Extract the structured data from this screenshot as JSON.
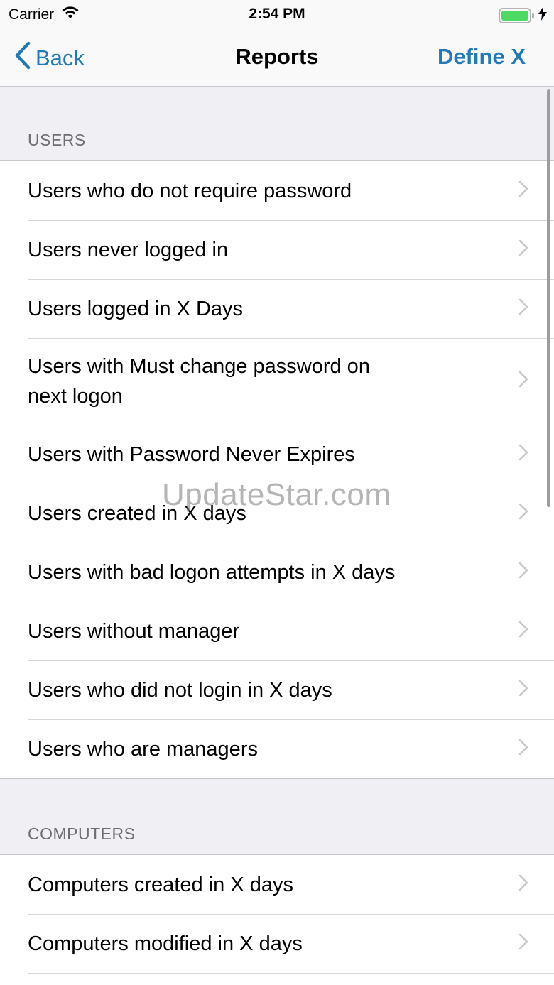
{
  "status_bar": {
    "carrier": "Carrier",
    "time": "2:54 PM",
    "icons": [
      "wifi-icon",
      "battery-icon",
      "charging-bolt-icon"
    ],
    "battery_color": "#4cd964"
  },
  "nav": {
    "back_label": "Back",
    "title": "Reports",
    "action_label": "Define X",
    "tint_color": "#1f7ab7"
  },
  "sections": [
    {
      "header": "USERS",
      "items": [
        {
          "label": "Users who do not require password"
        },
        {
          "label": "Users never logged in"
        },
        {
          "label": "Users logged in X Days"
        },
        {
          "label": "Users with Must change password on next logon"
        },
        {
          "label": "Users with Password Never Expires"
        },
        {
          "label": "Users created in X days"
        },
        {
          "label": "Users with bad logon attempts in X days"
        },
        {
          "label": "Users without manager"
        },
        {
          "label": "Users who did not login in X days"
        },
        {
          "label": "Users who are managers"
        }
      ]
    },
    {
      "header": "COMPUTERS",
      "items": [
        {
          "label": "Computers created in X days"
        },
        {
          "label": "Computers modified in X days"
        }
      ]
    }
  ],
  "watermark": "UpdateStar.com"
}
